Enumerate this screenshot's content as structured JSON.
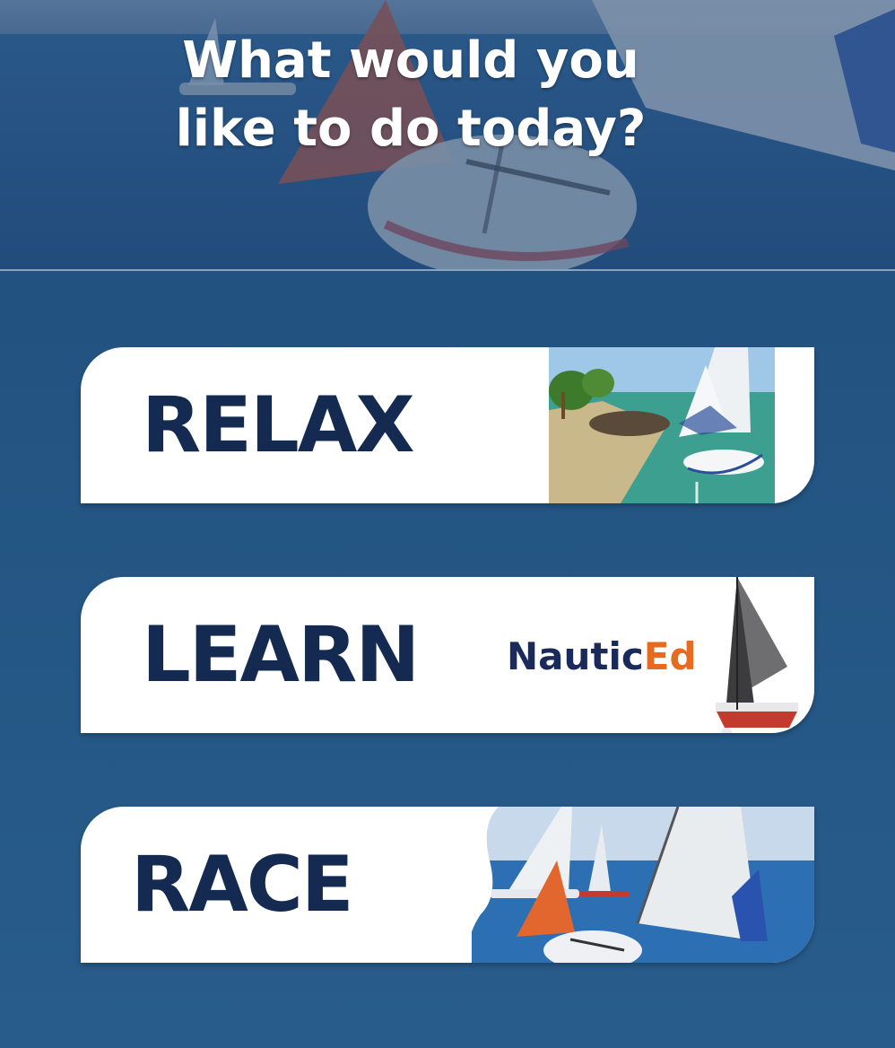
{
  "header": {
    "title_line1": "What would you",
    "title_line2": "like to do today?"
  },
  "menu": {
    "relax": {
      "label": "RELAX"
    },
    "learn": {
      "label": "LEARN",
      "logo_part1": "Nautic",
      "logo_part2": "Ed"
    },
    "race": {
      "label": "RACE"
    }
  },
  "colors": {
    "background": "#245583",
    "card": "#ffffff",
    "label_text": "#142a50",
    "logo_orange": "#e66a1f",
    "logo_navy": "#1a2a5a"
  }
}
